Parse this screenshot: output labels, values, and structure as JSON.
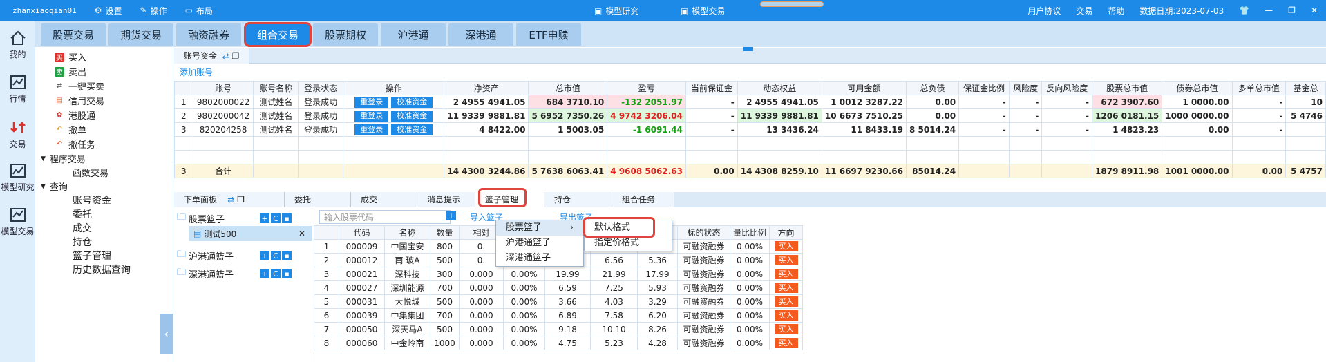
{
  "titlebar": {
    "user": "zhanxiaoqian01",
    "menu": [
      "设置",
      "操作",
      "布局"
    ],
    "center": [
      "模型研究",
      "模型交易"
    ],
    "right": [
      "用户协议",
      "交易",
      "帮助",
      "数据日期:2023-07-03"
    ]
  },
  "leftnav": [
    "我的",
    "行情",
    "交易",
    "模型研究",
    "模型交易"
  ],
  "tabs": [
    "股票交易",
    "期货交易",
    "融资融券",
    "组合交易",
    "股票期权",
    "沪港通",
    "深港通",
    "ETF申赎"
  ],
  "tree": {
    "items": [
      "买入",
      "卖出",
      "一键买卖",
      "信用交易",
      "港股通",
      "撤单",
      "撤任务"
    ],
    "prog": "程序交易",
    "prog_sub": "函数交易",
    "query": "查询",
    "query_sub": [
      "账号资金",
      "委托",
      "成交",
      "持仓",
      "篮子管理",
      "历史数据查询"
    ]
  },
  "account": {
    "tab": "账号资金",
    "add": "添加账号",
    "headers": [
      "",
      "账号",
      "账号名称",
      "登录状态",
      "操作",
      "净资产",
      "总市值",
      "盈亏",
      "当前保证金",
      "动态权益",
      "可用金额",
      "总负债",
      "保证金比例",
      "风险度",
      "反向风险度",
      "股票总市值",
      "债券总市值",
      "多单总市值",
      "基金总"
    ],
    "btn1": "重登录",
    "btn2": "校准资金",
    "rows": [
      [
        "1",
        "9802000022",
        "测试姓名",
        "登录成功",
        "",
        "2 4955 4941.05",
        "684 3710.10",
        "-132 2051.97",
        "-",
        "2 4955 4941.05",
        "1 0012 3287.22",
        "0.00",
        "-",
        "-",
        "-",
        "672 3907.60",
        "1 0000.00",
        "-",
        "10"
      ],
      [
        "2",
        "9802000042",
        "测试姓名",
        "登录成功",
        "",
        "11 9339 9881.81",
        "5 6952 7350.26",
        "4 9742 3206.04",
        "-",
        "11 9339 9881.81",
        "10 6673 7510.25",
        "0.00",
        "-",
        "-",
        "-",
        "1206 0181.15",
        "1000 0000.00",
        "-",
        "5 4746"
      ],
      [
        "3",
        "820204258",
        "测试姓名",
        "登录成功",
        "",
        "4 8422.00",
        "1 5003.05",
        "-1 6091.44",
        "-",
        "13 3436.24",
        "11 8433.19",
        "8 5014.24",
        "-",
        "-",
        "-",
        "1 4823.23",
        "0.00",
        "-",
        ""
      ]
    ],
    "total": [
      "3",
      "合计",
      "",
      "",
      "",
      "14 4300 3244.86",
      "5 7638 6063.41",
      "4 9608 5062.63",
      "0.00",
      "14 4308 8259.10",
      "11 6697 9230.66",
      "85014.24",
      "",
      "",
      "",
      "1879 8911.98",
      "1001 0000.00",
      "0.00",
      "5 4757"
    ]
  },
  "lower": {
    "tabs": [
      "下单面板",
      "委托",
      "成交",
      "消息提示",
      "篮子管理",
      "持仓",
      "组合任务"
    ],
    "baskets": [
      "股票篮子",
      "测试500",
      "沪港通篮子",
      "深港通篮子"
    ],
    "search_placeholder": "输入股票代码",
    "import": "导入篮子",
    "export": "导出篮子",
    "headers": [
      "",
      "代码",
      "名称",
      "数量",
      "相对",
      "",
      "",
      "跌停",
      "标的状态",
      "量比比例",
      "方向"
    ],
    "rows": [
      [
        "1",
        "000009",
        "中国宝安",
        "800",
        "0.",
        "",
        "",
        "10.86",
        "可融资融券",
        "0.00%",
        "买入"
      ],
      [
        "2",
        "000012",
        "南 玻A",
        "500",
        "0.",
        "",
        "6.56",
        "5.36",
        "可融资融券",
        "0.00%",
        "买入"
      ],
      [
        "3",
        "000021",
        "深科技",
        "300",
        "0.000",
        "0.00%",
        "19.99",
        "21.99",
        "17.99",
        "可融资融券",
        "0.00%",
        "买入"
      ],
      [
        "4",
        "000027",
        "深圳能源",
        "700",
        "0.000",
        "0.00%",
        "6.59",
        "7.25",
        "5.93",
        "可融资融券",
        "0.00%",
        "买入"
      ],
      [
        "5",
        "000031",
        "大悦城",
        "500",
        "0.000",
        "0.00%",
        "3.66",
        "4.03",
        "3.29",
        "可融资融券",
        "0.00%",
        "买入"
      ],
      [
        "6",
        "000039",
        "中集集团",
        "700",
        "0.000",
        "0.00%",
        "6.89",
        "7.58",
        "6.20",
        "可融资融券",
        "0.00%",
        "买入"
      ],
      [
        "7",
        "000050",
        "深天马A",
        "500",
        "0.000",
        "0.00%",
        "9.18",
        "10.10",
        "8.26",
        "可融资融券",
        "0.00%",
        "买入"
      ],
      [
        "8",
        "000060",
        "中金岭南",
        "1000",
        "0.000",
        "0.00%",
        "4.75",
        "5.23",
        "4.28",
        "可融资融券",
        "0.00%",
        "买入"
      ]
    ],
    "menu1": [
      "股票篮子",
      "沪港通篮子",
      "深港通篮子"
    ],
    "menu2": [
      "默认格式",
      "指定价格式"
    ]
  }
}
